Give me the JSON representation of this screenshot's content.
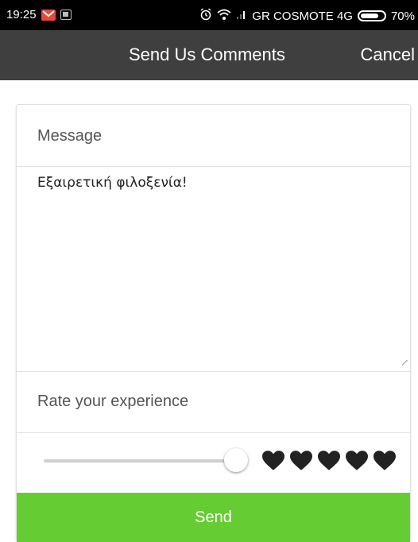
{
  "status_bar": {
    "time": "19:25",
    "carrier": "GR COSMOTE 4G",
    "battery": "70%",
    "icons": [
      "gmail-icon",
      "image-notification-icon",
      "alarm-icon",
      "wifi-icon",
      "signal-icon",
      "battery-icon"
    ]
  },
  "action_bar": {
    "title": "Send Us Comments",
    "cancel_label": "Cancel"
  },
  "form": {
    "message_label": "Message",
    "message_value": "Εξαιρετική φιλοξενία!",
    "rating_label": "Rate your experience",
    "rating": {
      "slider_fraction": 0.96,
      "hearts_total": 5
    },
    "send_label": "Send"
  },
  "colors": {
    "status_bar_bg": "#000000",
    "action_bar_bg": "#3f3f3f",
    "send_button_bg": "#66cc33",
    "heart_color": "#222222"
  }
}
